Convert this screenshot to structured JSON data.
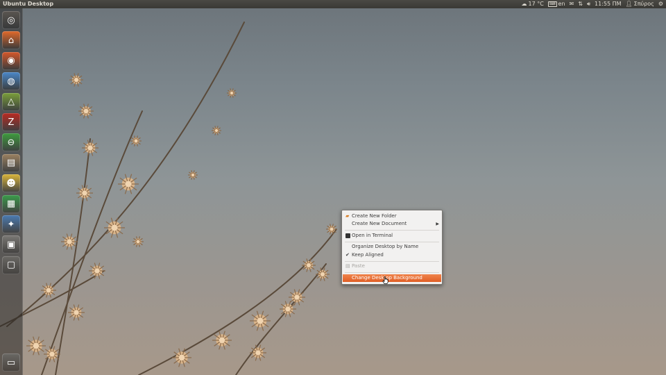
{
  "topbar": {
    "title": "Ubuntu Desktop",
    "weather": "17 °C",
    "keyboard": "en",
    "time": "11:55 ΠΜ",
    "user": "Σπύρος",
    "icons": [
      "cloud-icon",
      "keyboard-icon",
      "mail-icon",
      "network-icon",
      "volume-icon",
      "user-icon",
      "gear-icon"
    ]
  },
  "launcher": {
    "items": [
      {
        "name": "dash",
        "icon": "ubuntu-logo-icon",
        "glyph": "◎",
        "color": "#5a5550"
      },
      {
        "name": "home-folder",
        "icon": "folder-icon",
        "glyph": "⌂",
        "color": "#e0682a"
      },
      {
        "name": "firefox",
        "icon": "firefox-icon",
        "glyph": "◉",
        "color": "#d4572a"
      },
      {
        "name": "chromium",
        "icon": "chromium-icon",
        "glyph": "◍",
        "color": "#4a87c8"
      },
      {
        "name": "draw-app",
        "icon": "draw-icon",
        "glyph": "△",
        "color": "#7a9e3a"
      },
      {
        "name": "filezilla",
        "icon": "filezilla-icon",
        "glyph": "Z",
        "color": "#b82a22"
      },
      {
        "name": "sync-app",
        "icon": "sync-icon",
        "glyph": "⊖",
        "color": "#3d9a3d"
      },
      {
        "name": "archive-manager",
        "icon": "archive-icon",
        "glyph": "▤",
        "color": "#9a8060"
      },
      {
        "name": "pet-app",
        "icon": "pet-icon",
        "glyph": "☻",
        "color": "#d8b43a"
      },
      {
        "name": "spreadsheet",
        "icon": "spreadsheet-icon",
        "glyph": "▦",
        "color": "#3a9a4a"
      },
      {
        "name": "system-tool",
        "icon": "tools-icon",
        "glyph": "✦",
        "color": "#4a7ab0"
      },
      {
        "name": "screenshot",
        "icon": "camera-icon",
        "glyph": "▣",
        "color": "#7a7874"
      },
      {
        "name": "workspace-switcher",
        "icon": "workspace-icon",
        "glyph": "▢",
        "color": "#6a6864"
      }
    ],
    "trash": {
      "name": "trash",
      "icon": "trash-icon",
      "glyph": "▭",
      "color": "#6a6864"
    }
  },
  "context_menu": {
    "create_folder": "Create New Folder",
    "create_document": "Create New Document",
    "open_terminal": "Open in Terminal",
    "organize": "Organize Desktop by Name",
    "keep_aligned": "Keep Aligned",
    "paste": "Paste",
    "change_background": "Change Desktop Background"
  }
}
